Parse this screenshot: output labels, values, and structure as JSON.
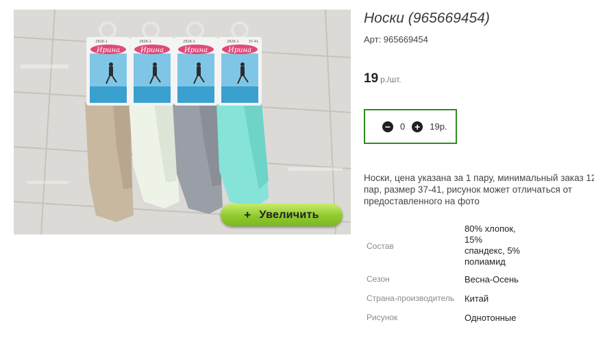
{
  "product": {
    "title": "Носки (965669454)",
    "sku": "Арт: 965669454",
    "price_value": "19",
    "price_unit": "р./шт.",
    "description": "Носки, цена указана за 1 пару, минимальный заказ 12 пар, размер 37-41, рисунок может отличаться от предоставленного на фото"
  },
  "image": {
    "zoom_label": "Увеличить",
    "zoom_icon": "+",
    "brand_label": "Ирина",
    "tag_codes": [
      "2826-1",
      "2826-1",
      "2826-1",
      "2826-1"
    ],
    "size_label": "37-41"
  },
  "quantity": {
    "minus_icon": "minus-circle-icon",
    "plus_icon": "plus-circle-icon",
    "value": "0",
    "total": "19р."
  },
  "properties": [
    {
      "name": "Состав",
      "value_lines": [
        "80% хлопок,",
        "15%",
        "спандекс, 5%",
        "полиамид"
      ]
    },
    {
      "name": "Сезон",
      "value": "Весна-Осень"
    },
    {
      "name": "Страна-производитель",
      "value": "Китай"
    },
    {
      "name": "Рисунок",
      "value": "Однотонные"
    }
  ],
  "colors": {
    "qty_border": "#2f8a1e",
    "zoom_button": "#8fc92e",
    "sock_beige": "#c8b8a0",
    "sock_white": "#eef3e8",
    "sock_gray": "#9a9ea6",
    "sock_mint": "#86e3d8"
  }
}
